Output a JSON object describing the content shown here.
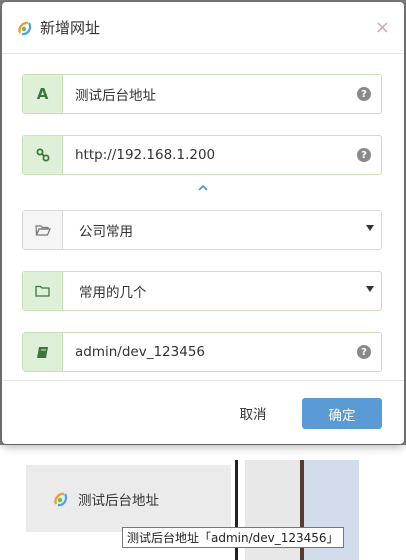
{
  "dialog": {
    "title": "新增网址",
    "close_glyph": "×",
    "cancel_label": "取消",
    "ok_label": "确定"
  },
  "fields": {
    "name": {
      "addon_glyph": "A",
      "value": "测试后台地址",
      "help_glyph": "?"
    },
    "url": {
      "icon": "link-icon",
      "value": "http://192.168.1.200",
      "help_glyph": "?"
    },
    "category": {
      "icon": "folder-open-icon",
      "value": "公司常用"
    },
    "subcategory": {
      "icon": "folder-icon",
      "value": "常用的几个"
    },
    "account": {
      "icon": "book-icon",
      "value": "admin/dev_123456",
      "help_glyph": "?"
    }
  },
  "preview": {
    "label": "测试后台地址",
    "tooltip": "测试后台地址「admin/dev_123456」"
  },
  "colors": {
    "addon_green_bg": "#dff0d8",
    "addon_green_border": "#c6e1b4",
    "primary_button": "#5b9bd5",
    "close_icon": "#d9a6a6"
  }
}
